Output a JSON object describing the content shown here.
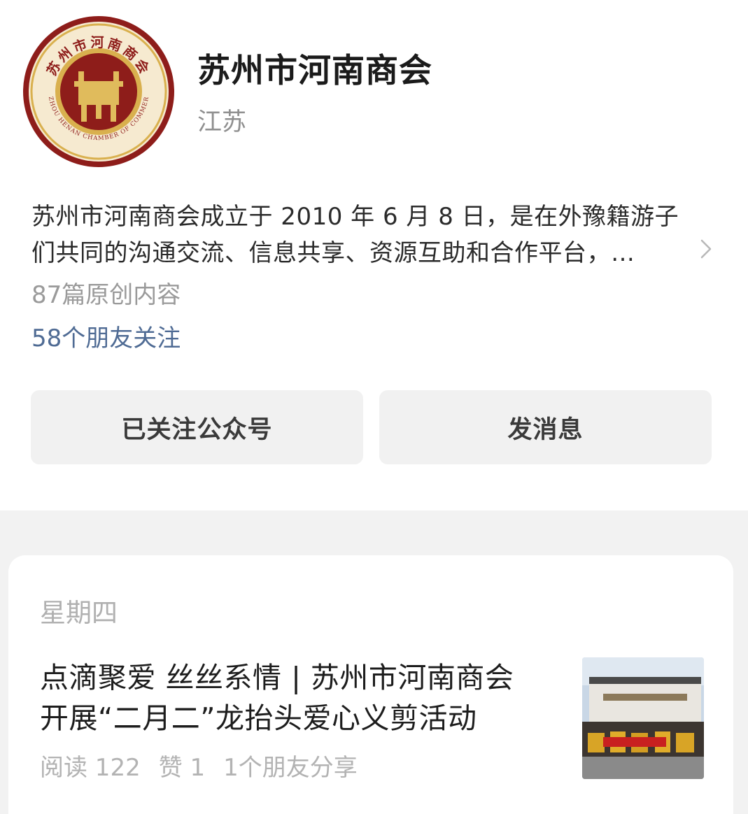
{
  "profile": {
    "name": "苏州市河南商会",
    "region": "江苏",
    "logo": {
      "text_cn": "苏州市河南商会",
      "text_en": "SUZHOU HENAN CHAMBER OF COMMERCE"
    },
    "description_line1": "苏州市河南商会成立于 2010 年 6 月 8 日，是在外豫籍游子",
    "description_line2": "们共同的沟通交流、信息共享、资源互助和合作平台，…",
    "original_count": "87篇原创内容",
    "friends_following": "58个朋友关注"
  },
  "actions": {
    "follow_label": "已关注公众号",
    "message_label": "发消息"
  },
  "feed": {
    "day_label": "星期四",
    "article": {
      "title_line1": "点滴聚爱 丝丝系情 | 苏州市河南商会",
      "title_line2": "开展“二月二”龙抬头爱心义剪活动",
      "reads": "阅读 122",
      "likes": "赞 1",
      "shares": "1个朋友分享"
    }
  },
  "colors": {
    "logo_ring": "#8e1d1a",
    "logo_gold": "#d9b04e",
    "link_blue": "#4f6b94",
    "button_bg": "#f1f1f1",
    "feed_bg": "#f2f2f2"
  },
  "icons": {
    "more": "chevron-right-icon"
  }
}
